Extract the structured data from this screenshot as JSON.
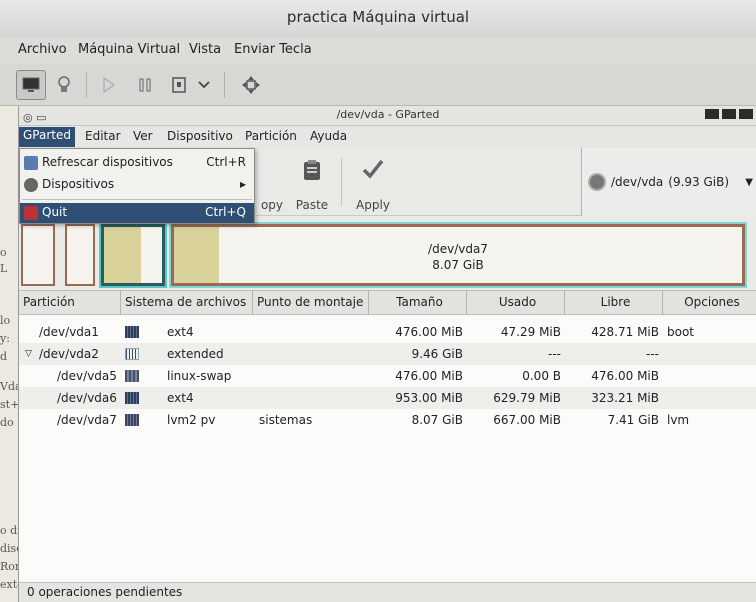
{
  "vm": {
    "window_title": "practica Máquina virtual",
    "menu": [
      "Archivo",
      "Máquina Virtual",
      "Vista",
      "Enviar Tecla"
    ],
    "toolbar_icons": [
      "monitor-icon",
      "lightbulb-icon",
      "play-icon",
      "pause-icon",
      "power-icon",
      "chevron-down-icon",
      "move-icon"
    ]
  },
  "side_fragments": [
    "o",
    "L",
    "lo",
    "y:",
    "d",
    "Vda",
    "st+",
    "do",
    "o di",
    "disc",
    "Ror",
    "exte"
  ],
  "gparted": {
    "window_title": "/dev/vda - GParted",
    "menu": [
      "GParted",
      "Editar",
      "Ver",
      "Dispositivo",
      "Partición",
      "Ayuda"
    ],
    "gparted_menu": [
      {
        "label": "Refrescar dispositivos",
        "accel": "Ctrl+R",
        "icon": "refresh-icon"
      },
      {
        "label": "Dispositivos",
        "accel": "▸",
        "icon": "devices-icon"
      },
      {
        "label": "Quit",
        "accel": "Ctrl+Q",
        "icon": "quit-icon"
      }
    ],
    "toolbar": {
      "copy_label": "opy",
      "paste_label": "Paste",
      "apply_label": "Apply"
    },
    "device": {
      "name": "/dev/vda",
      "size": "(9.93 GiB)"
    },
    "partmap_label": {
      "name": "/dev/vda7",
      "size": "8.07 GiB"
    },
    "columns": [
      "Partición",
      "Sistema de archivos",
      "Punto de montaje",
      "Tamaño",
      "Usado",
      "Libre",
      "Opciones"
    ],
    "rows": [
      {
        "partition": "/dev/vda1",
        "fs": "ext4",
        "mount": "",
        "size": "476.00 MiB",
        "used": "47.29 MiB",
        "free": "428.71 MiB",
        "flags": "boot"
      },
      {
        "partition": "/dev/vda2",
        "fs": "extended",
        "mount": "",
        "size": "9.46 GiB",
        "used": "---",
        "free": "---",
        "flags": ""
      },
      {
        "partition": "/dev/vda5",
        "fs": "linux-swap",
        "mount": "",
        "size": "476.00 MiB",
        "used": "0.00 B",
        "free": "476.00 MiB",
        "flags": ""
      },
      {
        "partition": "/dev/vda6",
        "fs": "ext4",
        "mount": "",
        "size": "953.00 MiB",
        "used": "629.79 MiB",
        "free": "323.21 MiB",
        "flags": ""
      },
      {
        "partition": "/dev/vda7",
        "fs": "lvm2 pv",
        "mount": "sistemas",
        "size": "8.07 GiB",
        "used": "667.00 MiB",
        "free": "7.41 GiB",
        "flags": "lvm"
      }
    ],
    "status": "0 operaciones pendientes"
  }
}
